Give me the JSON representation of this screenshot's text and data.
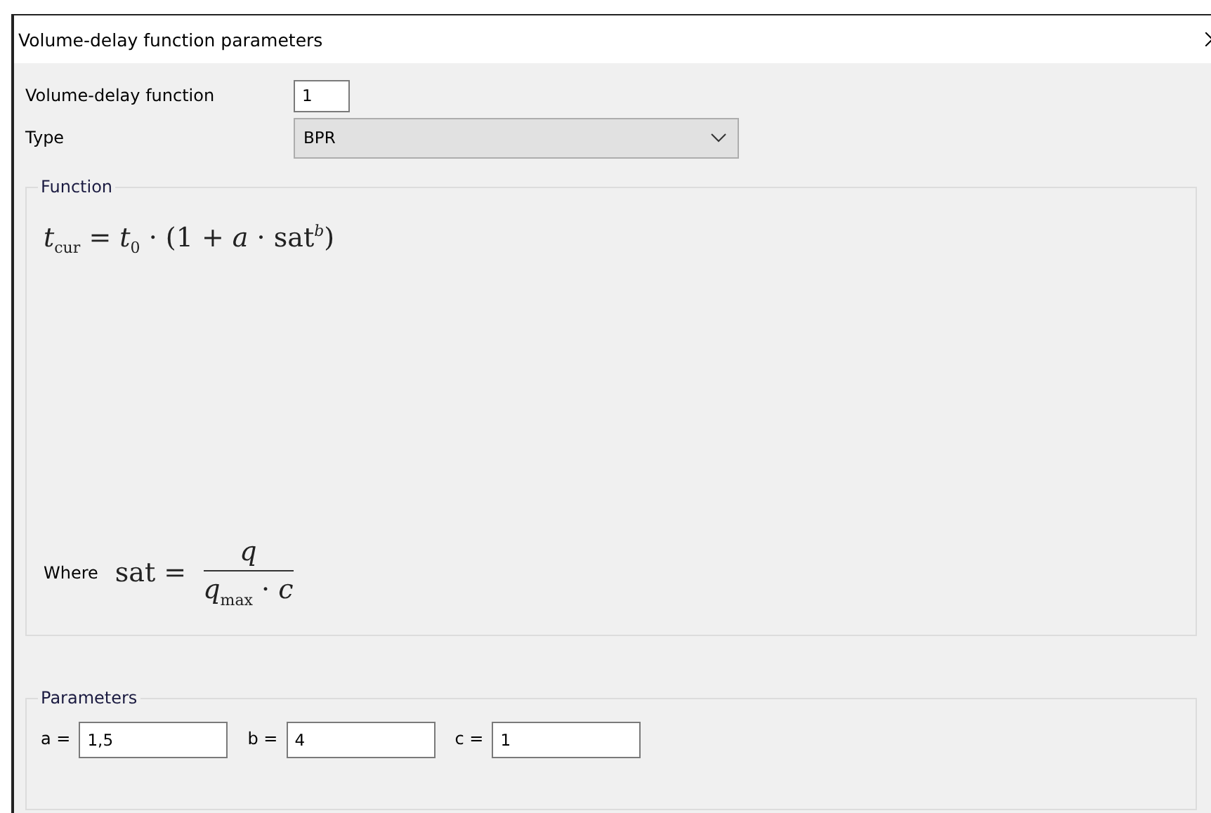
{
  "window": {
    "title": "Volume-delay function parameters"
  },
  "fields": [
    {
      "kind": "text",
      "label": "Volume-delay function",
      "value": "1"
    },
    {
      "kind": "combo",
      "label": "Type",
      "value": "BPR"
    }
  ],
  "function": {
    "title": "Function",
    "formula": "*t*$_{cur}$ = *t*$_{0}$ · (1 + *a* · sat$^{b}$)",
    "where_label": "Where",
    "where_lhs": "sat =",
    "numerator": "*q*",
    "denominator": "*q*$_{max}$ · *c*"
  },
  "parameters": {
    "title": "Parameters",
    "items": [
      {
        "label": "a =",
        "value": "1,5"
      },
      {
        "label": "b =",
        "value": "4"
      },
      {
        "label": "c =",
        "value": "1"
      }
    ]
  }
}
